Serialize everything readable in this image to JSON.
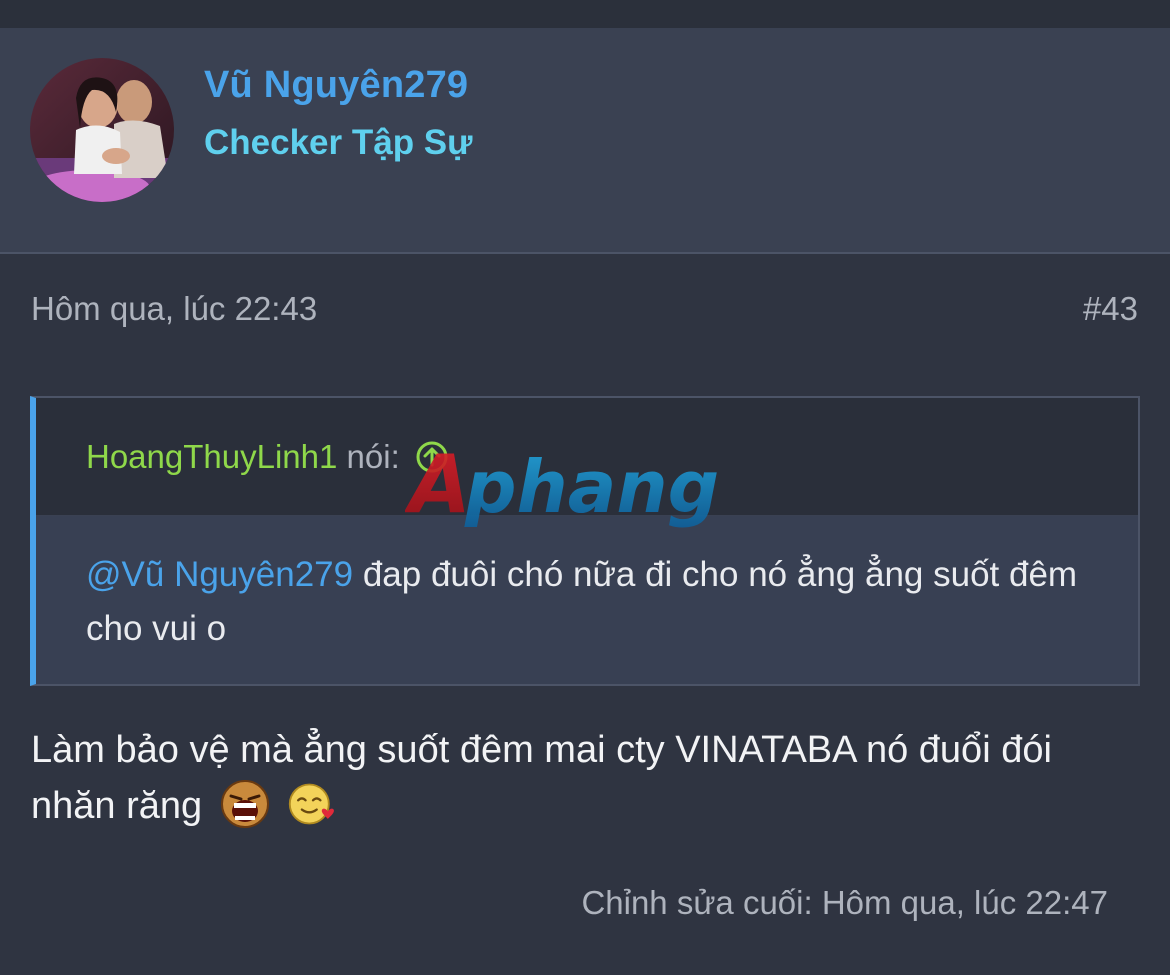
{
  "post": {
    "username": "Vũ Nguyên279",
    "user_title": "Checker Tập Sự",
    "avatar_icon": "avatar-photo",
    "date": "Hôm qua, lúc 22:43",
    "number": "#43"
  },
  "quote": {
    "author": "HoangThuyLinh1",
    "said": "nói:",
    "goto_icon": "arrow-up-circle-icon",
    "mention": "@Vũ Nguyên279",
    "text": " đap đuôi chó nữa đi cho nó ẳng ẳng suốt đêm cho vui o"
  },
  "watermark": {
    "text": "Aphang"
  },
  "message": {
    "text": "Làm bảo vệ mà ẳng suốt đêm mai cty VINATABA nó đuổi đói nhăn răng",
    "smilies": [
      "laughing-smilie",
      "love-smilie"
    ]
  },
  "footer": {
    "edited": "Chỉnh sửa cuối: Hôm qua, lúc 22:47"
  },
  "colors": {
    "username": "#4aa3ea",
    "user_title": "#5fd0ee",
    "quote_author": "#8fd84a",
    "quote_bar": "#4aa3ea"
  }
}
